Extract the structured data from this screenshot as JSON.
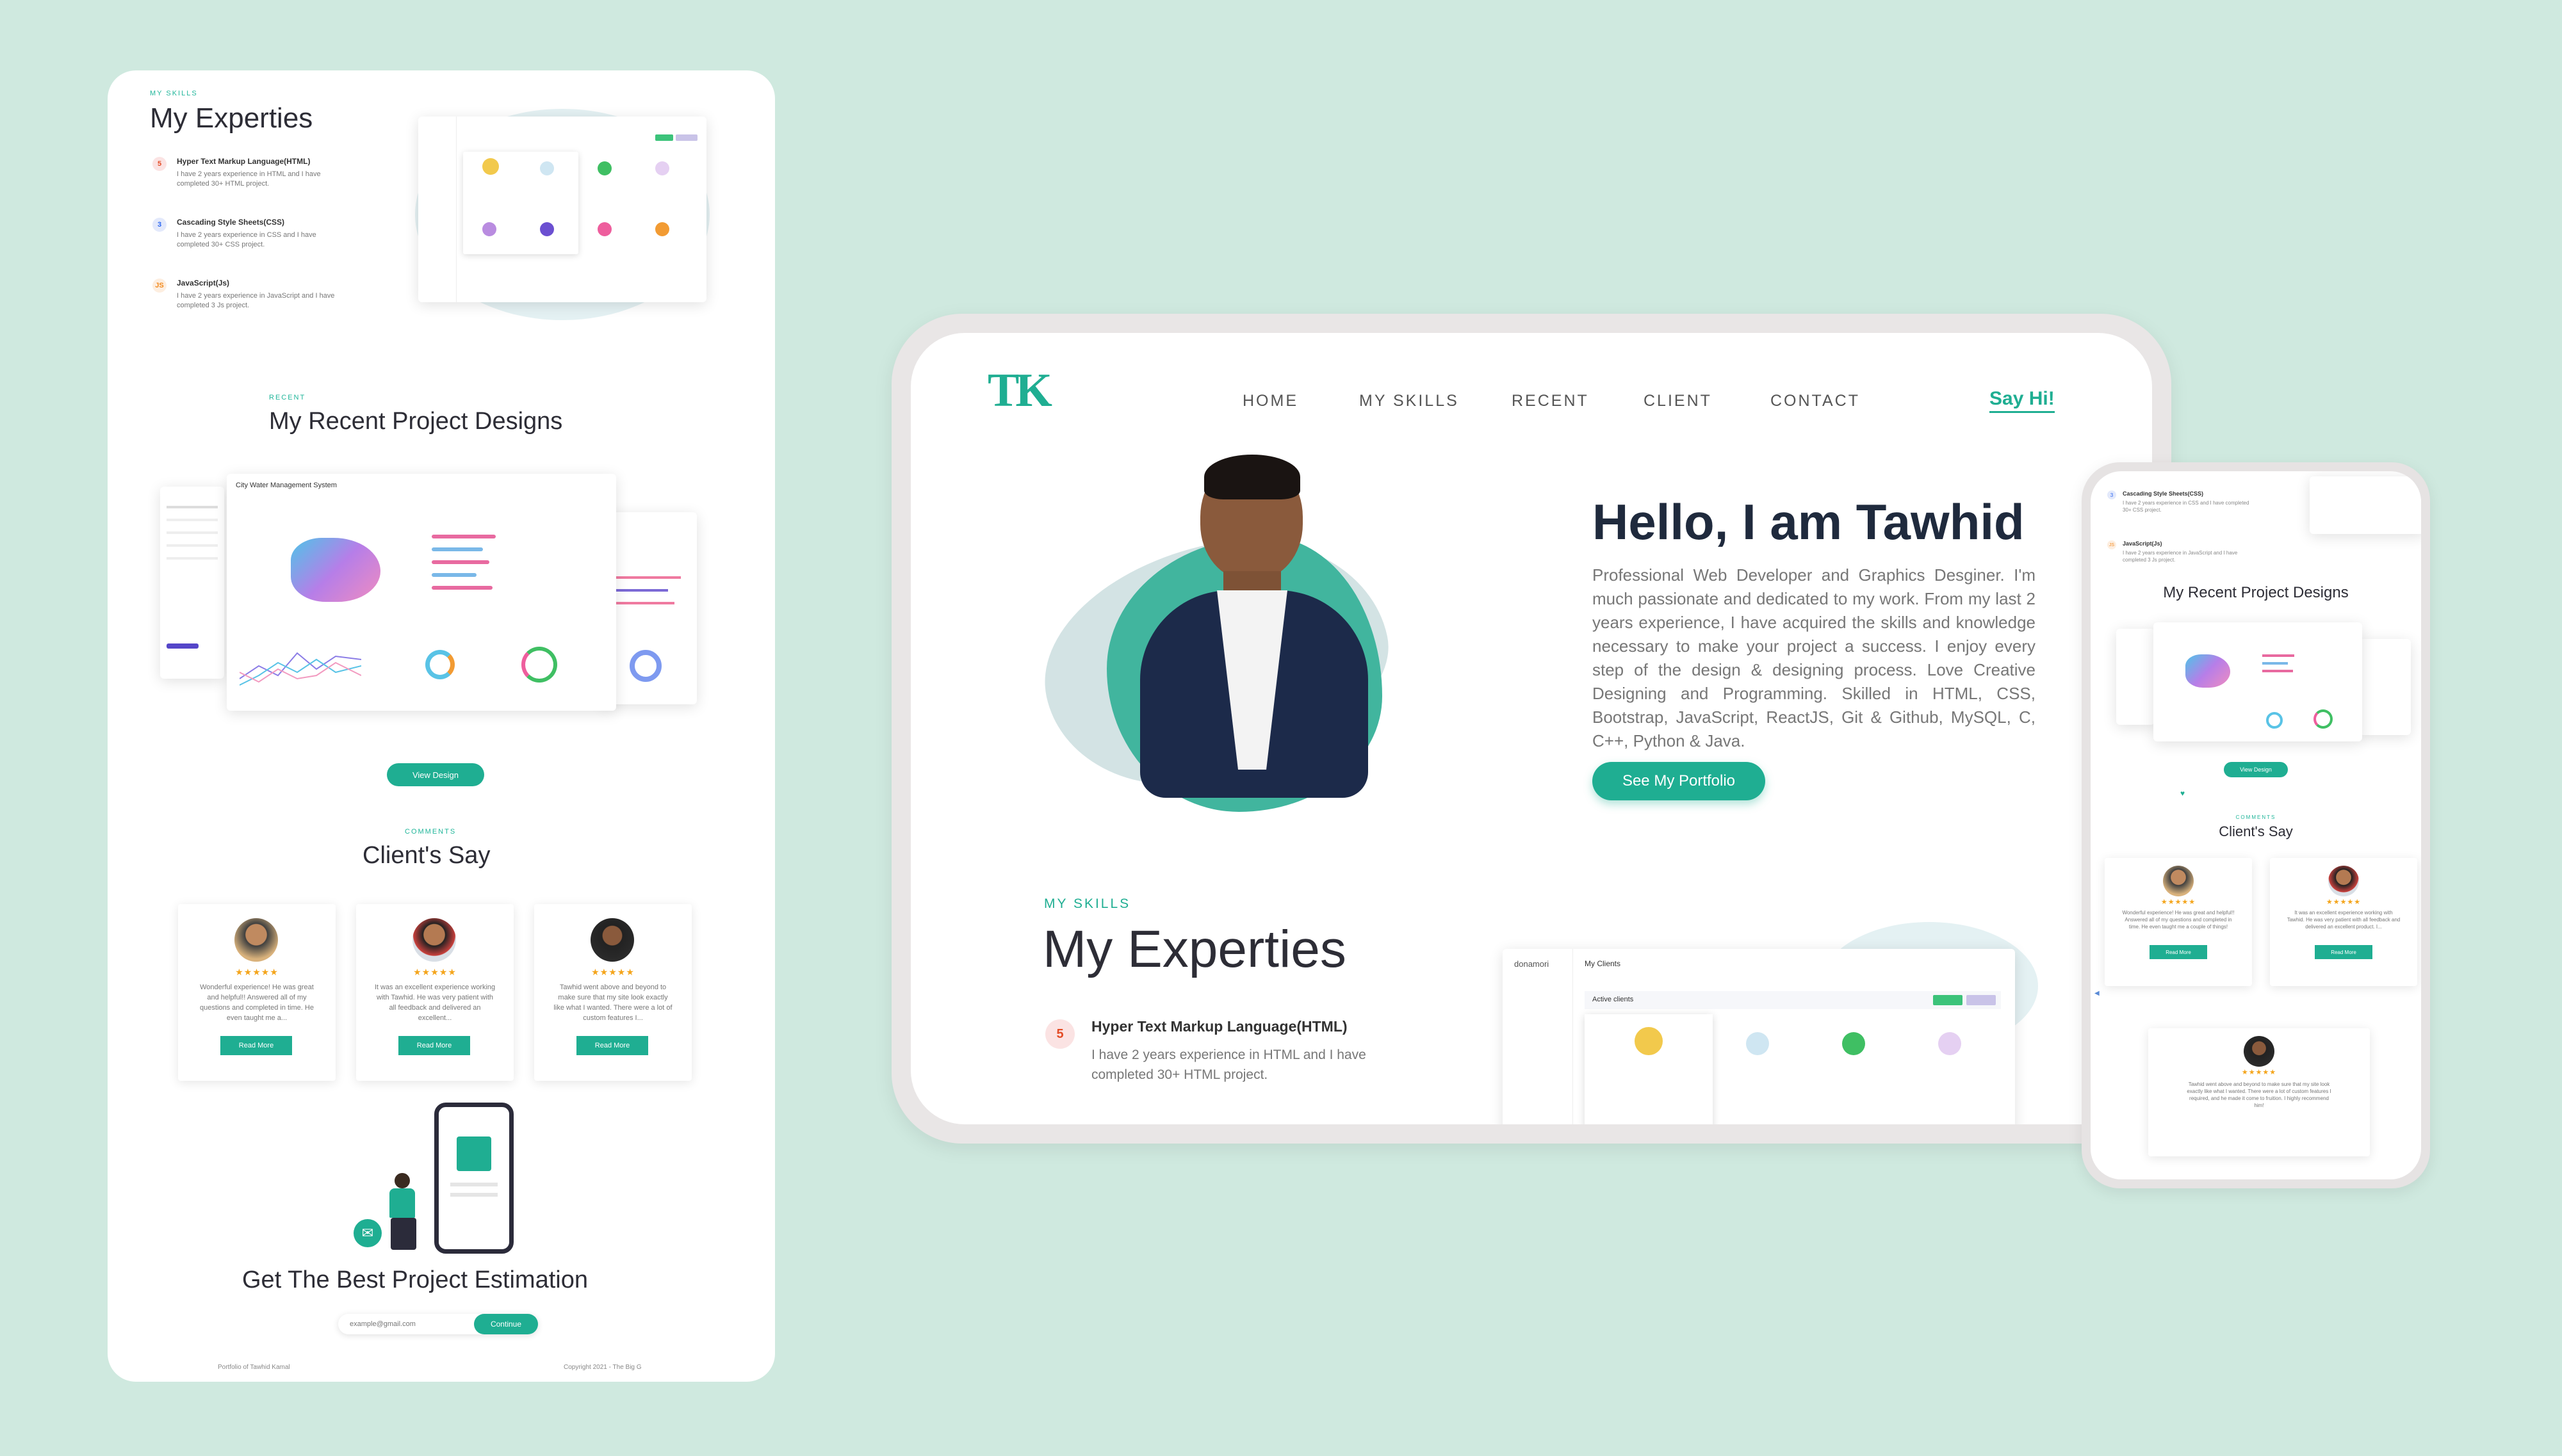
{
  "colors": {
    "background": "#cfe9df",
    "accent": "#1fae92",
    "heading": "#1f2a3d",
    "stars": "#f4a51c"
  },
  "long_page": {
    "skills_eyebrow": "MY SKILLS",
    "skills_title": "My Experties",
    "skills": [
      {
        "title": "Hyper Text Markup Language(HTML)",
        "desc": "I have 2 years experience in HTML and I have completed 30+ HTML project.",
        "icon": "html5-icon"
      },
      {
        "title": "Cascading Style Sheets(CSS)",
        "desc": "I have 2 years experience in CSS and I have completed 30+ CSS project.",
        "icon": "css3-icon"
      },
      {
        "title": "JavaScript(Js)",
        "desc": "I have 2 years experience in JavaScript and I have completed 3 Js project.",
        "icon": "js-icon"
      }
    ],
    "recent_eyebrow": "RECENT",
    "recent_title": "My Recent Project Designs",
    "project_title": "City Water Management System",
    "view_design": "View Design",
    "comments_eyebrow": "COMMENTS",
    "comments_title": "Client's Say",
    "comments": [
      {
        "stars": "★★★★★",
        "text": "Wonderful experience! He was great and helpful!! Answered all of my questions and completed in time. He even taught me a...",
        "button": "Read More"
      },
      {
        "stars": "★★★★★",
        "text": "It was an excellent experience working with Tawhid. He was very patient with all feedback and delivered an excellent...",
        "button": "Read More"
      },
      {
        "stars": "★★★★★",
        "text": "Tawhid went above and beyond to make sure that my site look exactly like what I wanted. There were a lot of custom features I...",
        "button": "Read More"
      }
    ],
    "estimation_title": "Get The Best Project Estimation",
    "email_placeholder": "example@gmail.com",
    "continue_label": "Continue",
    "footer_left": "Portfolio of Tawhid Kamal",
    "footer_right": "Copyright 2021 - The Big G"
  },
  "tablet": {
    "logo": "TK",
    "nav": [
      "HOME",
      "MY SKILLS",
      "RECENT",
      "CLIENT",
      "CONTACT"
    ],
    "say_hi": "Say Hi!",
    "hero_title": "Hello, I am Tawhid",
    "hero_text": "Professional Web Developer and Graphics Desginer. I'm much passionate and dedicated to my work. From my last 2 years experience, I have acquired the skills and knowledge necessary to make your project a success. I enjoy every step of the design & designing process. Love Creative Designing and Programming. Skilled in HTML, CSS, Bootstrap, JavaScript, ReactJS, Git & Github, MySQL, C, C++, Python & Java.",
    "hero_button": "See My Portfolio",
    "skills_eyebrow": "MY SKILLS",
    "skills_title": "My Experties",
    "skill_title": "Hyper Text Markup Language(HTML)",
    "skill_desc": "I have 2 years experience in HTML and I have completed 30+ HTML project.",
    "dashboard_brand": "donamori",
    "dashboard_title": "My Clients",
    "dashboard_tab": "Active clients"
  },
  "phone": {
    "skill_css_title": "Cascading Style Sheets(CSS)",
    "skill_css_desc": "I have 2 years experience in CSS and I have completed 30+ CSS project.",
    "skill_js_title": "JavaScript(Js)",
    "skill_js_desc": "I have 2 years experience in JavaScript and I have completed 3 Js project.",
    "recent_title": "My Recent Project Designs",
    "view_design": "View Design",
    "comments_eyebrow": "COMMENTS",
    "comments_title": "Client's Say",
    "comments": [
      {
        "stars": "★★★★★",
        "text": "Wonderful experience! He was great and helpful!! Answered all of my questions and completed in time. He even taught me a couple of things!",
        "button": "Read More"
      },
      {
        "stars": "★★★★★",
        "text": "It was an excellent experience working with Tawhid. He was very patient with all feedback and delivered an excellent product. I...",
        "button": "Read More"
      },
      {
        "stars": "★★★★★",
        "text": "Tawhid went above and beyond to make sure that my site look exactly like what I wanted. There were a lot of custom features I required, and he made it come to fruition. I highly recommend him!"
      }
    ]
  }
}
